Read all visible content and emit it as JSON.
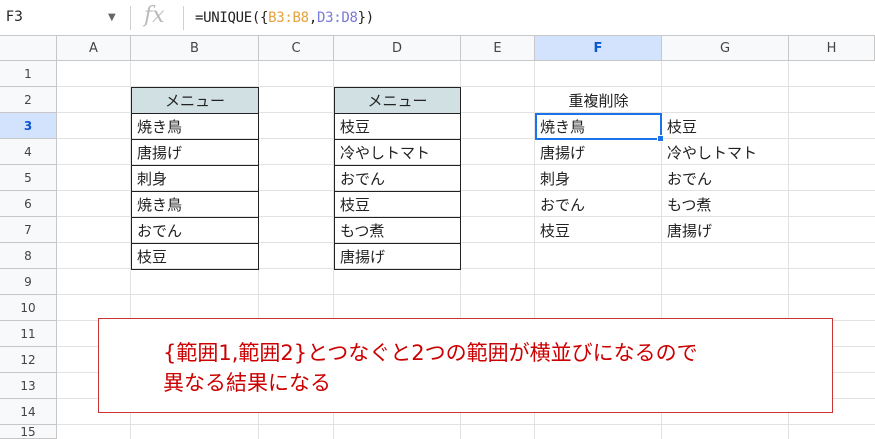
{
  "formula_bar": {
    "cell_ref": "F3",
    "fx_label": "fx",
    "formula_prefix": "=UNIQUE({",
    "formula_range1": "B3:B8",
    "formula_comma": ",",
    "formula_range2": "D3:D8",
    "formula_suffix": "})"
  },
  "columns": [
    "A",
    "B",
    "C",
    "D",
    "E",
    "F",
    "G",
    "H"
  ],
  "rows": [
    "1",
    "2",
    "3",
    "4",
    "5",
    "6",
    "7",
    "8",
    "9",
    "10",
    "11",
    "12",
    "13",
    "14",
    "15"
  ],
  "table_b": {
    "header": "メニュー",
    "items": [
      "焼き鳥",
      "唐揚げ",
      "刺身",
      "焼き鳥",
      "おでん",
      "枝豆"
    ]
  },
  "table_d": {
    "header": "メニュー",
    "items": [
      "枝豆",
      "冷やしトマト",
      "おでん",
      "枝豆",
      "もつ煮",
      "唐揚げ"
    ]
  },
  "result": {
    "header": "重複削除",
    "col_f": [
      "焼き鳥",
      "唐揚げ",
      "刺身",
      "おでん",
      "枝豆"
    ],
    "col_g": [
      "枝豆",
      "冷やしトマト",
      "おでん",
      "もつ煮",
      "唐揚げ"
    ]
  },
  "note": {
    "line1": "{範囲1,範囲2}とつなぐと2つの範囲が横並びになるので",
    "line2": "異なる結果になる"
  },
  "colors": {
    "accent": "#1a73e8",
    "range1": "#e6a23c",
    "range2": "#7a7ad8",
    "note_text": "#cc0000",
    "table_header_bg": "#d0e0e3"
  }
}
